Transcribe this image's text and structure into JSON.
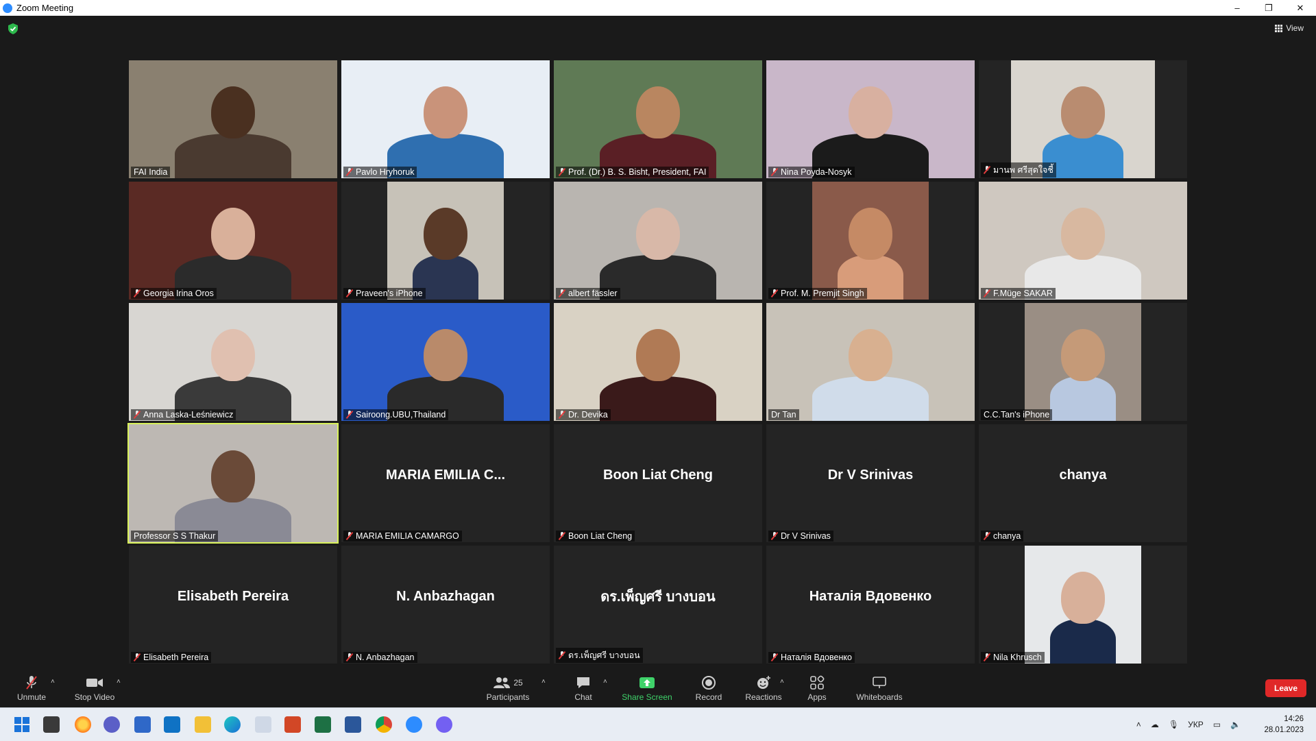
{
  "window": {
    "title": "Zoom Meeting",
    "controls": [
      "–",
      "❐",
      "✕"
    ]
  },
  "top_right": {
    "view_label": "View"
  },
  "tiles": [
    {
      "label": "FAI India",
      "muted": false,
      "type": "video",
      "bg": "#8a8070",
      "skin": "#4a3020",
      "shirt": "#4a3a30"
    },
    {
      "label": "Pavlo Hryhoruk",
      "muted": true,
      "type": "video",
      "bg": "#e8eef5",
      "skin": "#c9937a",
      "shirt": "#2f6fb0"
    },
    {
      "label": "Prof. (Dr.) B. S. Bisht, President, FAI",
      "muted": true,
      "type": "video",
      "bg": "#5f7a55",
      "skin": "#b98660",
      "shirt": "#5a1f25"
    },
    {
      "label": "Nina Poyda-Nosyk",
      "muted": true,
      "type": "video",
      "bg": "#c9b7c9",
      "skin": "#d8b0a0",
      "shirt": "#1b1b1b"
    },
    {
      "label": "มานพ ศรีสุดใจชี้",
      "muted": true,
      "type": "video",
      "bg": "#d9d5ce",
      "skin": "#b98c70",
      "shirt": "#3a8ed0",
      "narrow": true
    },
    {
      "label": "Georgia Irina Oros",
      "muted": true,
      "type": "video",
      "bg": "#5a2a24",
      "skin": "#d9b09a",
      "shirt": "#2b2b2b"
    },
    {
      "label": "Praveen's iPhone",
      "muted": true,
      "type": "video",
      "bg": "#c7c2b8",
      "skin": "#5a3a28",
      "shirt": "#2a3552",
      "narrow2": true
    },
    {
      "label": "albert fässler",
      "muted": true,
      "type": "video",
      "bg": "#b9b5b0",
      "skin": "#d8b8a8",
      "shirt": "#2a2a2a"
    },
    {
      "label": "Prof. M. Premjit Singh",
      "muted": true,
      "type": "video",
      "bg": "#8a5a4a",
      "skin": "#c58a65",
      "shirt": "#d89c7a",
      "narrow2": true
    },
    {
      "label": "F.Müge SAKAR",
      "muted": true,
      "type": "video",
      "bg": "#cfc8c0",
      "skin": "#d8b8a0",
      "shirt": "#e8e8e8"
    },
    {
      "label": "Anna Laska-Leśniewicz",
      "muted": true,
      "type": "video",
      "bg": "#d8d6d2",
      "skin": "#e0c0b0",
      "shirt": "#3a3a3a"
    },
    {
      "label": "Sairoong.UBU,Thailand",
      "muted": true,
      "type": "video",
      "bg": "#2a5bc8",
      "skin": "#b98a6a",
      "shirt": "#2a2a2a"
    },
    {
      "label": "Dr. Devika",
      "muted": true,
      "type": "video",
      "bg": "#d9d2c4",
      "skin": "#b07a55",
      "shirt": "#3a1a1a"
    },
    {
      "label": "Dr Tan",
      "muted": false,
      "type": "video",
      "bg": "#c8c2b8",
      "skin": "#d8b090",
      "shirt": "#d0dcea"
    },
    {
      "label": "C.C.Tan's iPhone",
      "muted": false,
      "type": "video",
      "bg": "#9a8e84",
      "skin": "#c59a78",
      "shirt": "#b8c8e0",
      "narrow2": true
    },
    {
      "label": "Professor S S Thakur",
      "muted": false,
      "type": "video",
      "active": true,
      "bg": "#bdb8b3",
      "skin": "#6a4a38",
      "shirt": "#8a8a95"
    },
    {
      "label": "MARIA EMILIA CAMARGO",
      "muted": true,
      "type": "name",
      "bigname": "MARIA EMILIA C..."
    },
    {
      "label": "Boon Liat Cheng",
      "muted": true,
      "type": "name",
      "bigname": "Boon Liat Cheng"
    },
    {
      "label": "Dr V Srinivas",
      "muted": true,
      "type": "name",
      "bigname": "Dr V Srinivas"
    },
    {
      "label": "chanya",
      "muted": true,
      "type": "name",
      "bigname": "chanya"
    },
    {
      "label": "Elisabeth Pereira",
      "muted": true,
      "type": "name",
      "bigname": "Elisabeth Pereira"
    },
    {
      "label": "N. Anbazhagan",
      "muted": true,
      "type": "name",
      "bigname": "N. Anbazhagan"
    },
    {
      "label": "ดร.เพ็ญศรี บางบอน",
      "muted": true,
      "type": "name",
      "bigname": "ดร.เพ็ญศรี บางบอน"
    },
    {
      "label": "Наталія Вдовенко",
      "muted": true,
      "type": "name",
      "bigname": "Наталія Вдовенко"
    },
    {
      "label": "Nila Khrusch",
      "muted": true,
      "type": "video",
      "bg": "#e6e8ea",
      "skin": "#d8b09a",
      "shirt": "#1a2a4a",
      "narrow2": true
    }
  ],
  "toolbar": {
    "unmute": "Unmute",
    "stop_video": "Stop Video",
    "participants": "Participants",
    "participants_count": "25",
    "chat": "Chat",
    "share_screen": "Share Screen",
    "record": "Record",
    "reactions": "Reactions",
    "apps": "Apps",
    "whiteboards": "Whiteboards",
    "leave": "Leave"
  },
  "taskbar": {
    "language": "УКР",
    "time": "14:26",
    "date": "28.01.2023"
  },
  "colors": {
    "accent_green": "#3fd26a",
    "leave_red": "#e02828",
    "active_speaker": "#d9f25a"
  }
}
